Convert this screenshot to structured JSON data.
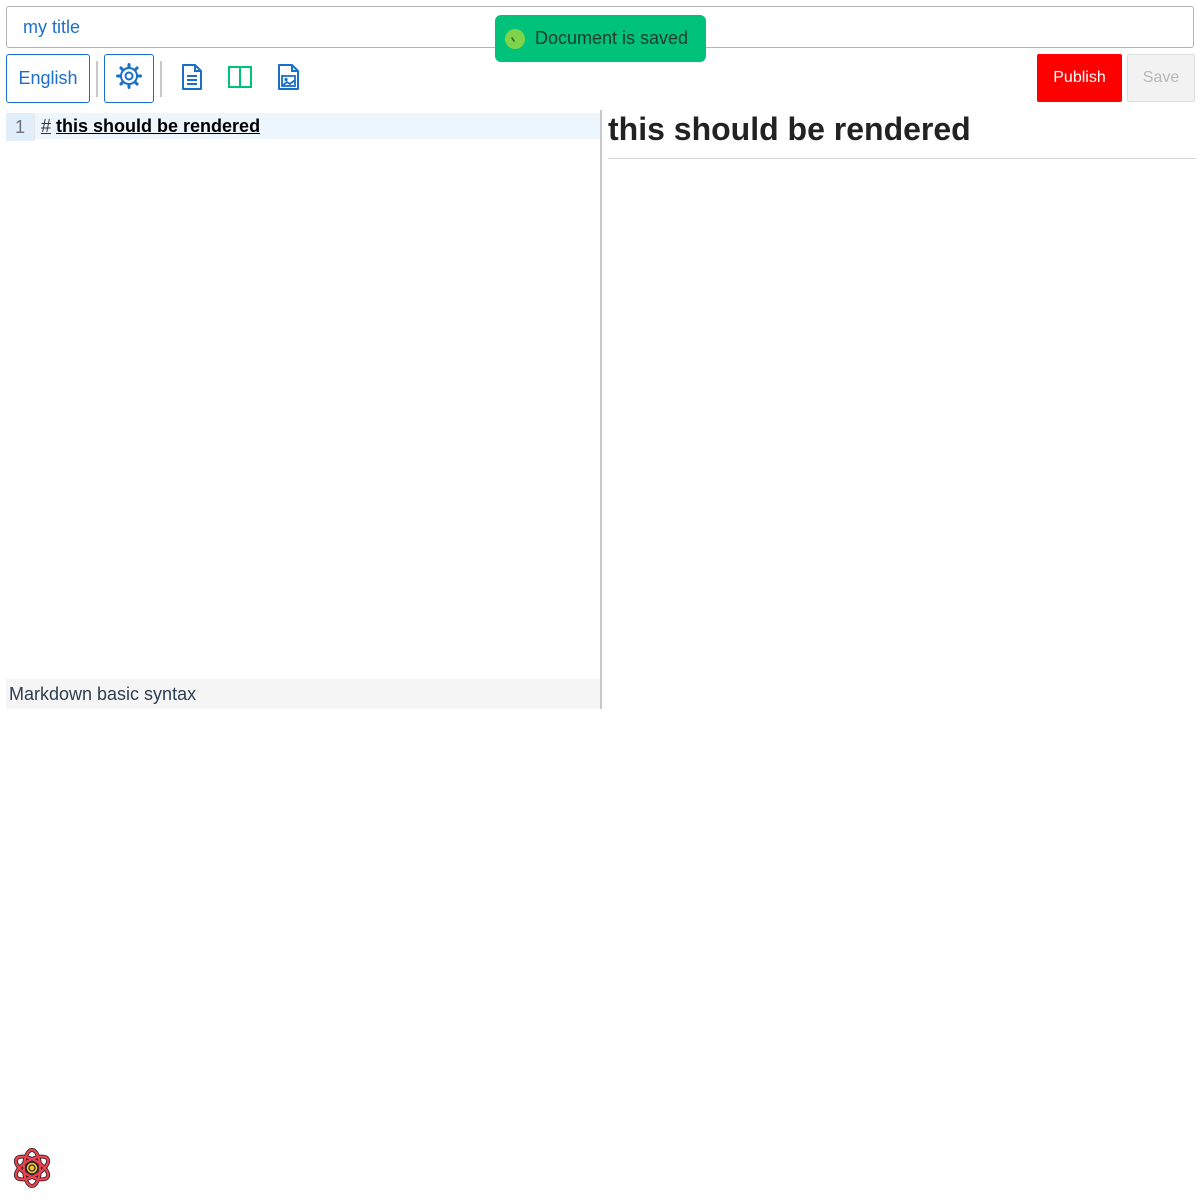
{
  "title_input": {
    "value": "my title"
  },
  "toast": {
    "message": "Document is saved",
    "color": "#00c27a"
  },
  "toolbar": {
    "language_label": "English",
    "icons": [
      "gear-icon",
      "editor-only-icon",
      "split-view-icon",
      "preview-only-icon"
    ],
    "publish_label": "Publish",
    "save_label": "Save",
    "publish_color": "#ff0000",
    "accent_color": "#1a6fc9"
  },
  "editor": {
    "lines": [
      {
        "number": "1",
        "marker": "#",
        "text": "this should be rendered"
      }
    ],
    "status_text": "Markdown basic syntax"
  },
  "preview": {
    "heading": "this should be rendered"
  },
  "logo": {
    "icon": "atom-logo-icon"
  }
}
